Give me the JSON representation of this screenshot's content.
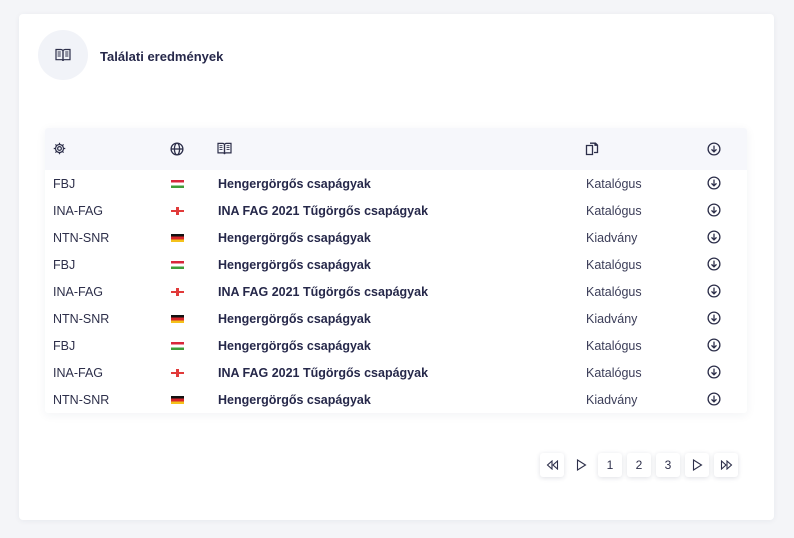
{
  "header": {
    "title": "Találati eredmények",
    "icon": "book-icon"
  },
  "table": {
    "columns": [
      {
        "icon": "gear-icon"
      },
      {
        "icon": "globe-icon"
      },
      {
        "icon": "book-icon"
      },
      {
        "icon": "documents-icon"
      },
      {
        "icon": "download-icon"
      }
    ],
    "rows": [
      {
        "brand": "FBJ",
        "flag": "hu",
        "title": "Hengergörgős csapágyak",
        "type": "Katalógus"
      },
      {
        "brand": "INA-FAG",
        "flag": "en",
        "title": "INA FAG 2021 Tűgörgős csapágyak",
        "type": "Katalógus"
      },
      {
        "brand": "NTN-SNR",
        "flag": "de",
        "title": "Hengergörgős csapágyak",
        "type": "Kiadvány"
      },
      {
        "brand": "FBJ",
        "flag": "hu",
        "title": "Hengergörgős csapágyak",
        "type": "Katalógus"
      },
      {
        "brand": "INA-FAG",
        "flag": "en",
        "title": "INA FAG 2021 Tűgörgős csapágyak",
        "type": "Katalógus"
      },
      {
        "brand": "NTN-SNR",
        "flag": "de",
        "title": "Hengergörgős csapágyak",
        "type": "Kiadvány"
      },
      {
        "brand": "FBJ",
        "flag": "hu",
        "title": "Hengergörgős csapágyak",
        "type": "Katalógus"
      },
      {
        "brand": "INA-FAG",
        "flag": "en",
        "title": "INA FAG 2021 Tűgörgős csapágyak",
        "type": "Katalógus"
      },
      {
        "brand": "NTN-SNR",
        "flag": "de",
        "title": "Hengergörgős csapágyak",
        "type": "Kiadvány"
      }
    ]
  },
  "pagination": {
    "pages": [
      "1",
      "2",
      "3"
    ],
    "first_icon": "first-page-icon",
    "prev_icon": "previous-page-icon",
    "next_icon": "next-page-icon",
    "last_icon": "last-page-icon"
  },
  "colors": {
    "text": "#26284a",
    "background": "#f4f5f8",
    "header_row": "#f6f7fb"
  }
}
